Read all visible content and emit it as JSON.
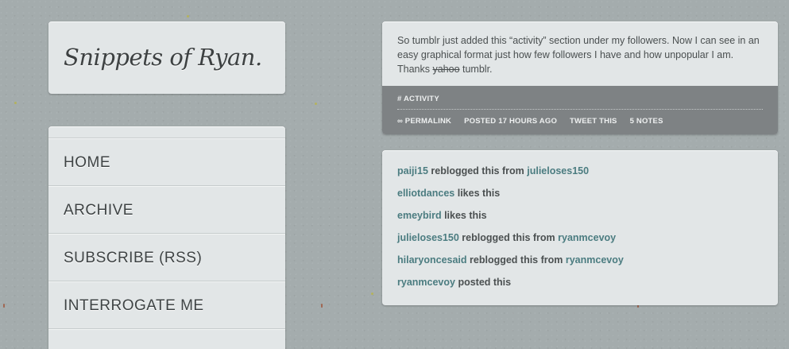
{
  "site": {
    "title": "Snippets of Ryan."
  },
  "nav": {
    "items": [
      {
        "label": "HOME"
      },
      {
        "label": "ARCHIVE"
      },
      {
        "label": "SUBSCRIBE (RSS)"
      },
      {
        "label": "INTERROGATE ME"
      }
    ]
  },
  "post": {
    "text_before": "So tumblr just added this “activity” section under my followers. Now I can see in an easy graphical format just how few followers I have and how unpopular I am. Thanks ",
    "text_struck": "yahoo",
    "text_after": " tumblr.",
    "tag": "# ACTIVITY",
    "meta": {
      "permalink": "∞ PERMALINK",
      "posted": "POSTED 17 HOURS AGO",
      "tweet": "TWEET THIS",
      "notes": "5 NOTES"
    }
  },
  "notes": [
    {
      "user": "paiji15",
      "action": " reblogged this from ",
      "source": "julieloses150"
    },
    {
      "user": "elliotdances",
      "action": " likes this",
      "source": ""
    },
    {
      "user": "emeybird",
      "action": " likes this",
      "source": ""
    },
    {
      "user": "julieloses150",
      "action": " reblogged this from ",
      "source": "ryanmcevoy"
    },
    {
      "user": "hilaryoncesaid",
      "action": " reblogged this from ",
      "source": "ryanmcevoy"
    },
    {
      "user": "ryanmcevoy",
      "action": " posted this",
      "source": ""
    }
  ],
  "colors": {
    "background": "#a4acad",
    "panel": "#e2e6e7",
    "meta_bar": "#7e8284",
    "link": "#4b7c80"
  }
}
